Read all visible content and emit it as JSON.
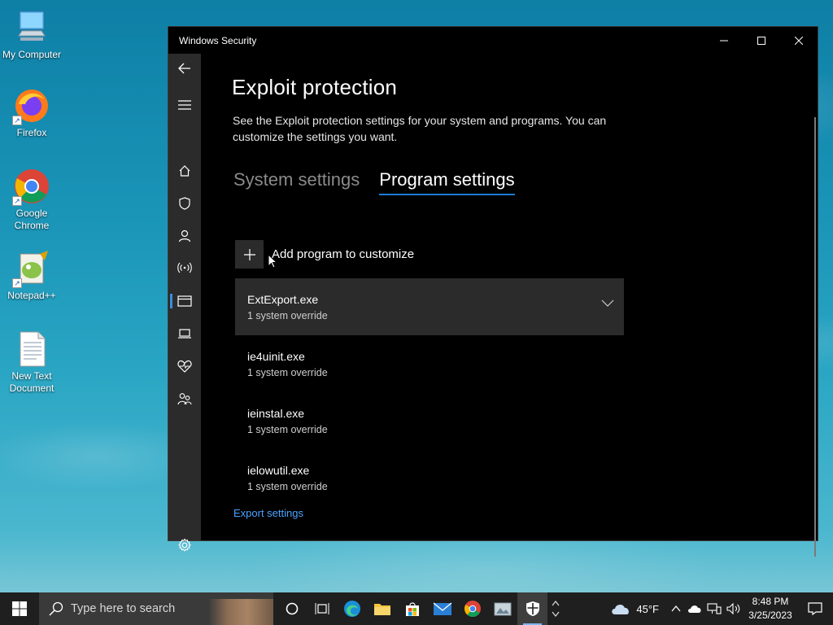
{
  "desktop": {
    "icons": [
      {
        "label": "My Computer",
        "icon": "computer-icon"
      },
      {
        "label": "Firefox",
        "icon": "firefox-icon"
      },
      {
        "label": "Google Chrome",
        "icon": "chrome-icon"
      },
      {
        "label": "Notepad++",
        "icon": "notepadpp-icon"
      },
      {
        "label": "New Text Document",
        "icon": "text-document-icon"
      }
    ]
  },
  "window": {
    "title": "Windows Security",
    "controls": {
      "minimize": "minimize-icon",
      "maximize": "maximize-icon",
      "close": "close-icon"
    }
  },
  "nav": {
    "items": [
      "back-icon",
      "menu-icon",
      "home-icon",
      "shield-icon",
      "person-icon",
      "network-icon",
      "app-browser-icon",
      "device-icon",
      "heart-icon",
      "family-icon",
      "gear-icon"
    ],
    "active": "app-browser-icon"
  },
  "page": {
    "title": "Exploit protection",
    "description": "See the Exploit protection settings for your system and programs.  You can customize the settings you want.",
    "tabs": [
      {
        "label": "System settings",
        "selected": false
      },
      {
        "label": "Program settings",
        "selected": true
      }
    ],
    "add_program_label": "Add program to customize",
    "programs": [
      {
        "name": "ExtExport.exe",
        "overrides": "1 system override",
        "expanded": true
      },
      {
        "name": "ie4uinit.exe",
        "overrides": "1 system override",
        "expanded": false
      },
      {
        "name": "ieinstal.exe",
        "overrides": "1 system override",
        "expanded": false
      },
      {
        "name": "ielowutil.exe",
        "overrides": "1 system override",
        "expanded": false
      }
    ],
    "export_link": "Export settings"
  },
  "taskbar": {
    "search_placeholder": "Type here to search",
    "weather_temp": "45°F",
    "time": "8:48 PM",
    "date": "3/25/2023"
  },
  "colors": {
    "accent": "#1f7ad4",
    "link": "#4aa3ff",
    "window_bg": "#000000",
    "rail_bg": "#2b2b2b"
  }
}
